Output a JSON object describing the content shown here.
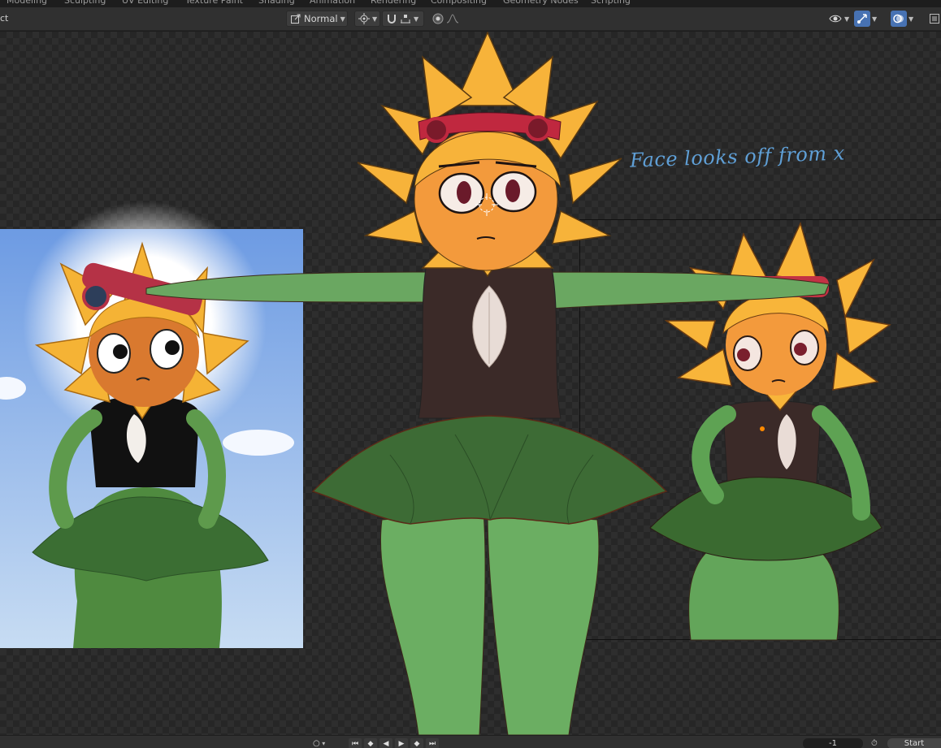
{
  "workspace_tabs": [
    "Modeling",
    "Sculpting",
    "UV Editing",
    "Texture Paint",
    "Shading",
    "Animation",
    "Rendering",
    "Compositing",
    "Geometry Nodes",
    "Scripting"
  ],
  "header": {
    "mode_fragment": "ct",
    "orientation_label": "Normal"
  },
  "annotation_note": "Face looks off from x",
  "footer": {
    "current_frame": "-1",
    "start_label": "Start"
  },
  "colors": {
    "accent": "#4772b3",
    "note": "#5f9fd6",
    "petal": "#f7b33a",
    "body_green": "#6aa761",
    "skirt_green": "#3d6b35",
    "shirt": "#3b2a28"
  }
}
